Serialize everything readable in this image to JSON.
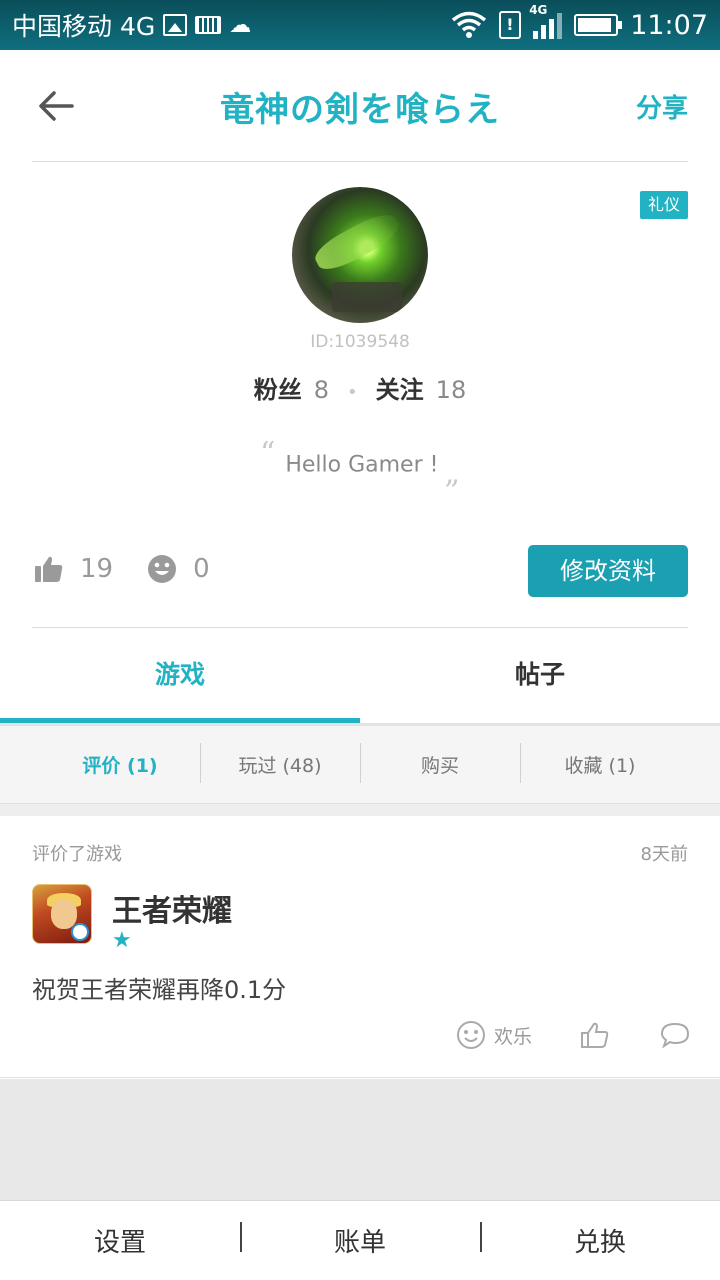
{
  "status_bar": {
    "carrier": "中国移动 4G",
    "network_small": "4G",
    "time": "11:07",
    "battery_level": 0.9,
    "icons": [
      "photo-icon",
      "keyboard-icon",
      "cloud-icon",
      "wifi-icon",
      "sim-alert-icon",
      "signal-icon",
      "battery-icon"
    ]
  },
  "header": {
    "title": "竜神の剣を喰らえ",
    "share_label": "分享"
  },
  "profile": {
    "badge": "礼仪",
    "user_id": "ID:1039548",
    "fans_label": "粉丝",
    "fans_count": "8",
    "following_label": "关注",
    "following_count": "18",
    "bio": "Hello Gamer !",
    "quote_open": "“",
    "quote_close": "„",
    "likes": "19",
    "smiles": "0",
    "edit_label": "修改资料"
  },
  "tabs": [
    {
      "label": "游戏",
      "active": true
    },
    {
      "label": "帖子",
      "active": false
    }
  ],
  "subtabs": [
    {
      "label": "评价 (1)",
      "active": true
    },
    {
      "label": "玩过 (48)",
      "active": false
    },
    {
      "label": "购买",
      "active": false
    },
    {
      "label": "收藏 (1)",
      "active": false
    }
  ],
  "review": {
    "action": "评价了游戏",
    "time": "8天前",
    "game_name": "王者荣耀",
    "rating_stars": 1,
    "star_glyph": "★",
    "text": "祝贺王者荣耀再降0.1分",
    "reaction_label": "欢乐"
  },
  "bottom_bar": {
    "settings": "设置",
    "bills": "账单",
    "redeem": "兑换"
  },
  "colors": {
    "accent": "#21b3c4",
    "button": "#1aa0b0",
    "status_bar": "#0f6f7f"
  }
}
